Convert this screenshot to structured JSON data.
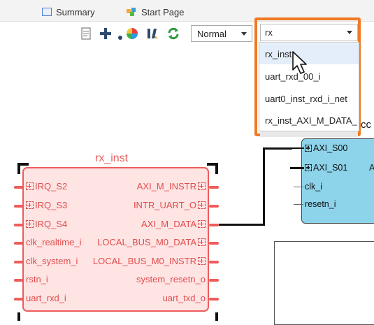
{
  "tabs": [
    {
      "label": "Summary",
      "icon": "summary-doc-icon"
    },
    {
      "label": "Start Page",
      "icon": "start-page-icon"
    }
  ],
  "toolbar": {
    "icons": [
      "report-icon",
      "add-icon",
      "color-wheel-icon",
      "tcl-icon",
      "refresh-icon"
    ],
    "mode_value": "Normal"
  },
  "search": {
    "value": "rx",
    "results": [
      "rx_inst",
      "uart_rxd_00_i",
      "uart0_inst_rxd_i_net",
      "rx_inst_AXI_M_DATA_"
    ],
    "selected_index": 0
  },
  "blue_block": {
    "partial_title": "rcc",
    "ports_left": [
      "AXI_S00",
      "AXI_S01",
      "clk_i",
      "resetn_i"
    ],
    "right_letter": "A"
  },
  "rx_block": {
    "title": "rx_inst",
    "ports_left": [
      "IRQ_S2",
      "IRQ_S3",
      "IRQ_S4",
      "clk_realtime_i",
      "clk_system_i",
      "rstn_i",
      "uart_rxd_i"
    ],
    "ports_right": [
      "AXI_M_INSTR",
      "INTR_UART_O",
      "AXI_M_DATA",
      "LOCAL_BUS_M0_DATA",
      "LOCAL_BUS_M0_INSTR",
      "system_resetn_o",
      "uart_txd_o"
    ]
  },
  "colors": {
    "highlight": "#f07a24",
    "block_blue": "#8dd3ea",
    "block_red": "#ee5c5c",
    "block_red_fill": "#ffe4e4"
  }
}
